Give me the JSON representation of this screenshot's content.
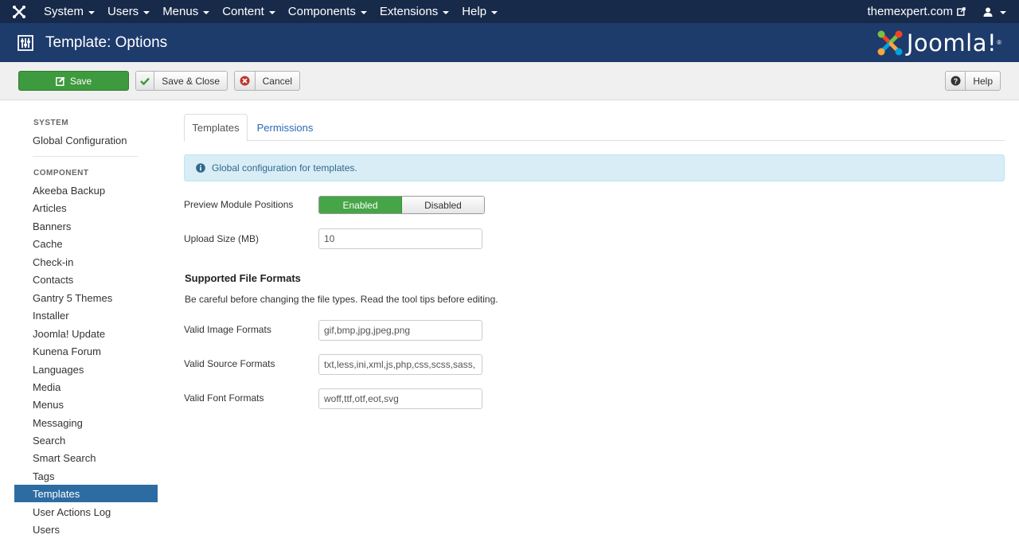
{
  "navbar": {
    "logo_icon": "joomla-icon",
    "menu": [
      "System",
      "Users",
      "Menus",
      "Content",
      "Components",
      "Extensions",
      "Help"
    ],
    "site_name": "themexpert.com",
    "external_icon": "external-link-icon",
    "user_icon": "user-icon"
  },
  "header": {
    "title": "Template: Options",
    "title_icon": "sliders-icon",
    "brand": "Joomla!"
  },
  "toolbar": {
    "save_label": "Save",
    "save_close_label": "Save & Close",
    "cancel_label": "Cancel",
    "help_label": "Help"
  },
  "sidebar": {
    "system_header": "SYSTEM",
    "global_config": "Global Configuration",
    "component_header": "COMPONENT",
    "items": [
      "Akeeba Backup",
      "Articles",
      "Banners",
      "Cache",
      "Check-in",
      "Contacts",
      "Gantry 5 Themes",
      "Installer",
      "Joomla! Update",
      "Kunena Forum",
      "Languages",
      "Media",
      "Menus",
      "Messaging",
      "Search",
      "Smart Search",
      "Tags",
      "Templates",
      "User Actions Log",
      "Users"
    ],
    "active": "Templates"
  },
  "tabs": {
    "templates": "Templates",
    "permissions": "Permissions"
  },
  "alert": {
    "text": "Global configuration for templates."
  },
  "form": {
    "preview_label": "Preview Module Positions",
    "preview_enabled": "Enabled",
    "preview_disabled": "Disabled",
    "preview_value": "Enabled",
    "upload_label": "Upload Size (MB)",
    "upload_value": "10",
    "section_title": "Supported File Formats",
    "section_desc": "Be careful before changing the file types. Read the tool tips before editing.",
    "image_label": "Valid Image Formats",
    "image_value": "gif,bmp,jpg,jpeg,png",
    "source_label": "Valid Source Formats",
    "source_value": "txt,less,ini,xml,js,php,css,scss,sass,",
    "font_label": "Valid Font Formats",
    "font_value": "woff,ttf,otf,eot,svg"
  },
  "colors": {
    "navbar": "#182a4a",
    "header": "#1d3b6b",
    "save": "#3e9a3e",
    "active_sidebar": "#2d6ca2",
    "link": "#2a69b8"
  }
}
